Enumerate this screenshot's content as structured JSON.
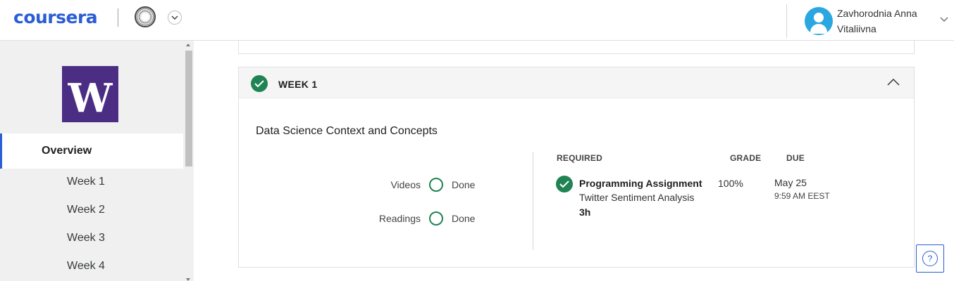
{
  "header": {
    "logo_text": "coursera",
    "user_name": "Zavhorodnia Anna Vitaliivna"
  },
  "sidebar": {
    "uw_logo_letter": "W",
    "items": [
      {
        "label": "Overview",
        "active": true
      },
      {
        "label": "Week 1"
      },
      {
        "label": "Week 2"
      },
      {
        "label": "Week 3"
      },
      {
        "label": "Week 4"
      }
    ]
  },
  "week": {
    "title": "WEEK 1",
    "completed": true,
    "module_title": "Data Science Context and Concepts",
    "progress": [
      {
        "label": "Videos",
        "status": "Done"
      },
      {
        "label": "Readings",
        "status": "Done"
      }
    ],
    "columns": {
      "required": "REQUIRED",
      "grade": "GRADE",
      "due": "DUE"
    },
    "assignment": {
      "type": "Programming Assignment",
      "name": "Twitter Sentiment Analysis",
      "duration": "3h",
      "grade": "100%",
      "due_date": "May 25",
      "due_time": "9:59 AM EEST"
    }
  },
  "help": {
    "icon_glyph": "?"
  },
  "colors": {
    "brand_blue": "#2a5dd6",
    "success_green": "#1f8354",
    "uw_purple": "#4b2e83"
  }
}
